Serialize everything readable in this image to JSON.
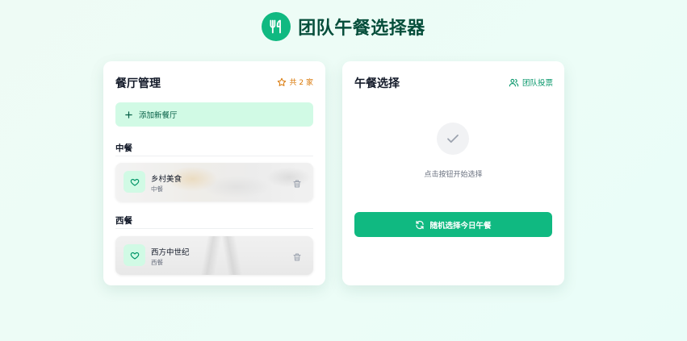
{
  "app": {
    "title": "团队午餐选择器",
    "logo_icon": "fork-knife-icon",
    "accent": "#10b981"
  },
  "management": {
    "title": "餐厅管理",
    "count_label": "共 2 家",
    "add_label": "添加新餐厅",
    "categories": [
      {
        "name": "中餐",
        "restaurants": [
          {
            "name": "乡村美食",
            "category": "中餐"
          }
        ]
      },
      {
        "name": "西餐",
        "restaurants": [
          {
            "name": "西方中世纪",
            "category": "西餐"
          }
        ]
      }
    ]
  },
  "selection": {
    "title": "午餐选择",
    "vote_label": "团队投票",
    "hint": "点击按钮开始选择",
    "random_label": "随机选择今日午餐"
  }
}
